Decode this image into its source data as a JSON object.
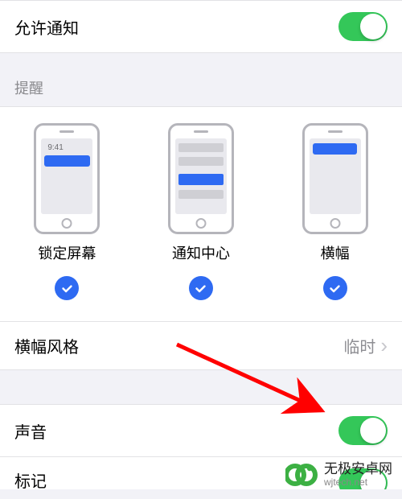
{
  "allow_notifications": {
    "label": "允许通知",
    "enabled": true
  },
  "alerts": {
    "section_title": "提醒",
    "lock_screen_time": "9:41",
    "options": [
      {
        "label": "锁定屏幕",
        "checked": true
      },
      {
        "label": "通知中心",
        "checked": true
      },
      {
        "label": "横幅",
        "checked": true
      }
    ]
  },
  "banner_style": {
    "label": "横幅风格",
    "value": "临时"
  },
  "sounds": {
    "label": "声音",
    "enabled": true
  },
  "badges": {
    "label": "标记",
    "enabled": true
  },
  "watermark": {
    "title": "无极安卓网",
    "url": "wjtech.net"
  }
}
